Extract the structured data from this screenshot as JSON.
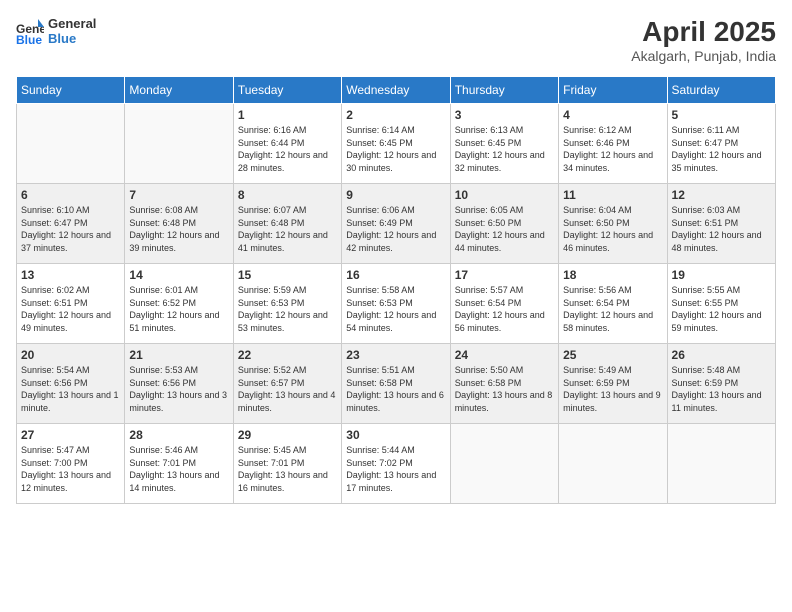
{
  "header": {
    "logo_general": "General",
    "logo_blue": "Blue",
    "title": "April 2025",
    "location": "Akalgarh, Punjab, India"
  },
  "weekdays": [
    "Sunday",
    "Monday",
    "Tuesday",
    "Wednesday",
    "Thursday",
    "Friday",
    "Saturday"
  ],
  "weeks": [
    [
      {
        "day": "",
        "sunrise": "",
        "sunset": "",
        "daylight": ""
      },
      {
        "day": "",
        "sunrise": "",
        "sunset": "",
        "daylight": ""
      },
      {
        "day": "1",
        "sunrise": "Sunrise: 6:16 AM",
        "sunset": "Sunset: 6:44 PM",
        "daylight": "Daylight: 12 hours and 28 minutes."
      },
      {
        "day": "2",
        "sunrise": "Sunrise: 6:14 AM",
        "sunset": "Sunset: 6:45 PM",
        "daylight": "Daylight: 12 hours and 30 minutes."
      },
      {
        "day": "3",
        "sunrise": "Sunrise: 6:13 AM",
        "sunset": "Sunset: 6:45 PM",
        "daylight": "Daylight: 12 hours and 32 minutes."
      },
      {
        "day": "4",
        "sunrise": "Sunrise: 6:12 AM",
        "sunset": "Sunset: 6:46 PM",
        "daylight": "Daylight: 12 hours and 34 minutes."
      },
      {
        "day": "5",
        "sunrise": "Sunrise: 6:11 AM",
        "sunset": "Sunset: 6:47 PM",
        "daylight": "Daylight: 12 hours and 35 minutes."
      }
    ],
    [
      {
        "day": "6",
        "sunrise": "Sunrise: 6:10 AM",
        "sunset": "Sunset: 6:47 PM",
        "daylight": "Daylight: 12 hours and 37 minutes."
      },
      {
        "day": "7",
        "sunrise": "Sunrise: 6:08 AM",
        "sunset": "Sunset: 6:48 PM",
        "daylight": "Daylight: 12 hours and 39 minutes."
      },
      {
        "day": "8",
        "sunrise": "Sunrise: 6:07 AM",
        "sunset": "Sunset: 6:48 PM",
        "daylight": "Daylight: 12 hours and 41 minutes."
      },
      {
        "day": "9",
        "sunrise": "Sunrise: 6:06 AM",
        "sunset": "Sunset: 6:49 PM",
        "daylight": "Daylight: 12 hours and 42 minutes."
      },
      {
        "day": "10",
        "sunrise": "Sunrise: 6:05 AM",
        "sunset": "Sunset: 6:50 PM",
        "daylight": "Daylight: 12 hours and 44 minutes."
      },
      {
        "day": "11",
        "sunrise": "Sunrise: 6:04 AM",
        "sunset": "Sunset: 6:50 PM",
        "daylight": "Daylight: 12 hours and 46 minutes."
      },
      {
        "day": "12",
        "sunrise": "Sunrise: 6:03 AM",
        "sunset": "Sunset: 6:51 PM",
        "daylight": "Daylight: 12 hours and 48 minutes."
      }
    ],
    [
      {
        "day": "13",
        "sunrise": "Sunrise: 6:02 AM",
        "sunset": "Sunset: 6:51 PM",
        "daylight": "Daylight: 12 hours and 49 minutes."
      },
      {
        "day": "14",
        "sunrise": "Sunrise: 6:01 AM",
        "sunset": "Sunset: 6:52 PM",
        "daylight": "Daylight: 12 hours and 51 minutes."
      },
      {
        "day": "15",
        "sunrise": "Sunrise: 5:59 AM",
        "sunset": "Sunset: 6:53 PM",
        "daylight": "Daylight: 12 hours and 53 minutes."
      },
      {
        "day": "16",
        "sunrise": "Sunrise: 5:58 AM",
        "sunset": "Sunset: 6:53 PM",
        "daylight": "Daylight: 12 hours and 54 minutes."
      },
      {
        "day": "17",
        "sunrise": "Sunrise: 5:57 AM",
        "sunset": "Sunset: 6:54 PM",
        "daylight": "Daylight: 12 hours and 56 minutes."
      },
      {
        "day": "18",
        "sunrise": "Sunrise: 5:56 AM",
        "sunset": "Sunset: 6:54 PM",
        "daylight": "Daylight: 12 hours and 58 minutes."
      },
      {
        "day": "19",
        "sunrise": "Sunrise: 5:55 AM",
        "sunset": "Sunset: 6:55 PM",
        "daylight": "Daylight: 12 hours and 59 minutes."
      }
    ],
    [
      {
        "day": "20",
        "sunrise": "Sunrise: 5:54 AM",
        "sunset": "Sunset: 6:56 PM",
        "daylight": "Daylight: 13 hours and 1 minute."
      },
      {
        "day": "21",
        "sunrise": "Sunrise: 5:53 AM",
        "sunset": "Sunset: 6:56 PM",
        "daylight": "Daylight: 13 hours and 3 minutes."
      },
      {
        "day": "22",
        "sunrise": "Sunrise: 5:52 AM",
        "sunset": "Sunset: 6:57 PM",
        "daylight": "Daylight: 13 hours and 4 minutes."
      },
      {
        "day": "23",
        "sunrise": "Sunrise: 5:51 AM",
        "sunset": "Sunset: 6:58 PM",
        "daylight": "Daylight: 13 hours and 6 minutes."
      },
      {
        "day": "24",
        "sunrise": "Sunrise: 5:50 AM",
        "sunset": "Sunset: 6:58 PM",
        "daylight": "Daylight: 13 hours and 8 minutes."
      },
      {
        "day": "25",
        "sunrise": "Sunrise: 5:49 AM",
        "sunset": "Sunset: 6:59 PM",
        "daylight": "Daylight: 13 hours and 9 minutes."
      },
      {
        "day": "26",
        "sunrise": "Sunrise: 5:48 AM",
        "sunset": "Sunset: 6:59 PM",
        "daylight": "Daylight: 13 hours and 11 minutes."
      }
    ],
    [
      {
        "day": "27",
        "sunrise": "Sunrise: 5:47 AM",
        "sunset": "Sunset: 7:00 PM",
        "daylight": "Daylight: 13 hours and 12 minutes."
      },
      {
        "day": "28",
        "sunrise": "Sunrise: 5:46 AM",
        "sunset": "Sunset: 7:01 PM",
        "daylight": "Daylight: 13 hours and 14 minutes."
      },
      {
        "day": "29",
        "sunrise": "Sunrise: 5:45 AM",
        "sunset": "Sunset: 7:01 PM",
        "daylight": "Daylight: 13 hours and 16 minutes."
      },
      {
        "day": "30",
        "sunrise": "Sunrise: 5:44 AM",
        "sunset": "Sunset: 7:02 PM",
        "daylight": "Daylight: 13 hours and 17 minutes."
      },
      {
        "day": "",
        "sunrise": "",
        "sunset": "",
        "daylight": ""
      },
      {
        "day": "",
        "sunrise": "",
        "sunset": "",
        "daylight": ""
      },
      {
        "day": "",
        "sunrise": "",
        "sunset": "",
        "daylight": ""
      }
    ]
  ]
}
